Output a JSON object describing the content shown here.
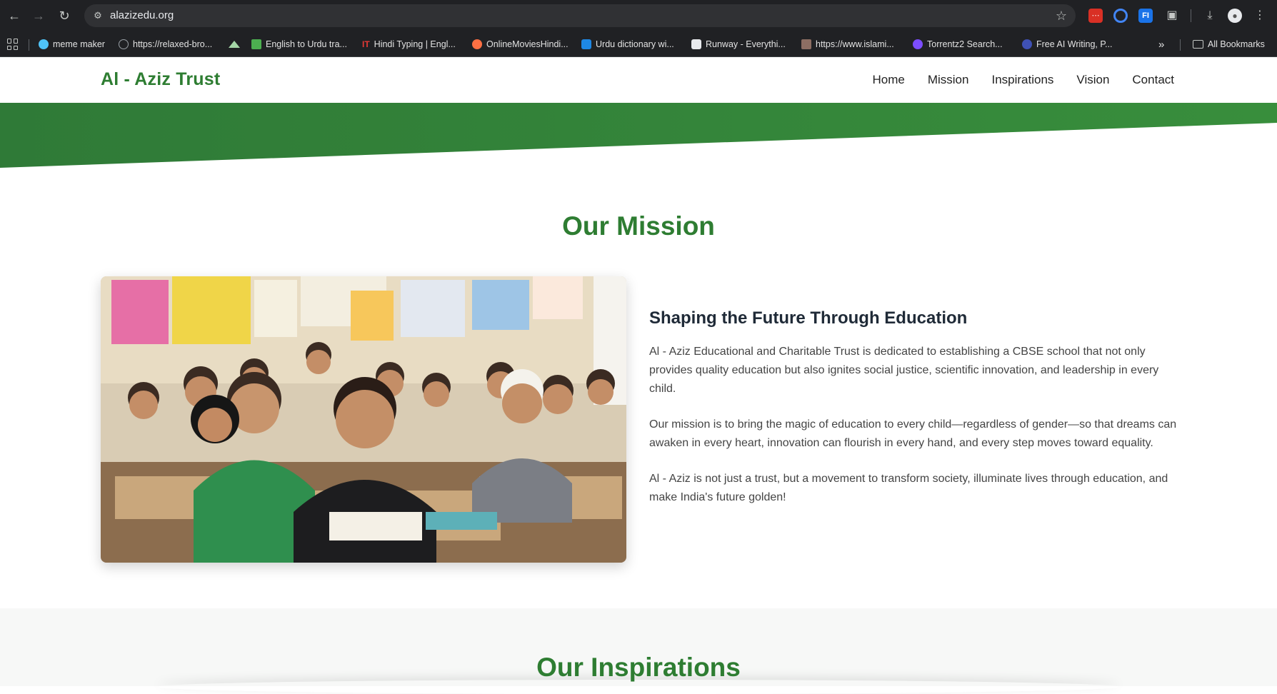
{
  "browser": {
    "url": "alazizedu.org",
    "bookmarks": [
      {
        "label": "meme maker",
        "color": "#4fc3f7"
      },
      {
        "label": "https://relaxed-bro...",
        "color": "#9aa0a6"
      },
      {
        "label": "",
        "color": "#a5d6a7"
      },
      {
        "label": "English to Urdu tra...",
        "color": "#4caf50"
      },
      {
        "label": "Hindi Typing | Engl...",
        "color": "#e53935"
      },
      {
        "label": "OnlineMoviesHindi...",
        "color": "#ff7043"
      },
      {
        "label": "Urdu dictionary wi...",
        "color": "#1e88e5"
      },
      {
        "label": "Runway - Everythi...",
        "color": "#e8eaed"
      },
      {
        "label": "https://www.islami...",
        "color": "#8d6e63"
      },
      {
        "label": "Torrentz2 Search...",
        "color": "#7c4dff"
      },
      {
        "label": "Free AI Writing, P...",
        "color": "#3f51b5"
      }
    ],
    "all_bookmarks_label": "All Bookmarks"
  },
  "site": {
    "logo": "Al - Aziz Trust",
    "nav": [
      "Home",
      "Mission",
      "Inspirations",
      "Vision",
      "Contact"
    ],
    "brand_color": "#2e7d32"
  },
  "mission": {
    "title": "Our Mission",
    "heading": "Shaping the Future Through Education",
    "paragraphs": [
      "Al - Aziz Educational and Charitable Trust is dedicated to establishing a CBSE school that not only provides quality education but also ignites social justice, scientific innovation, and leadership in every child.",
      "Our mission is to bring the magic of education to every child—regardless of gender—so that dreams can awaken in every heart, innovation can flourish in every hand, and every step moves toward equality.",
      "Al - Aziz is not just a trust, but a movement to transform society, illuminate lives through education, and make India's future golden!"
    ]
  },
  "inspirations": {
    "title": "Our Inspirations"
  }
}
